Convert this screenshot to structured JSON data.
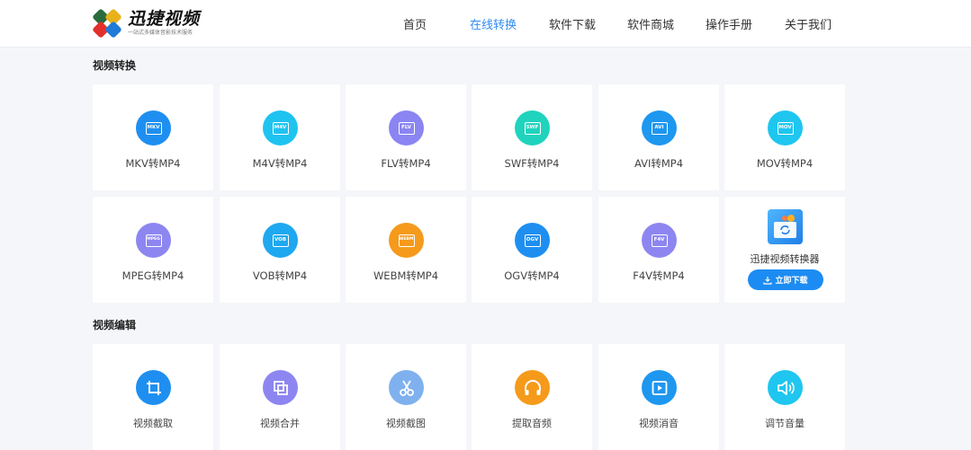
{
  "header": {
    "logo_title": "迅捷视频",
    "logo_subtitle": "一站式多媒体音影技术服务",
    "nav": [
      {
        "label": "首页",
        "active": false
      },
      {
        "label": "在线转换",
        "active": true
      },
      {
        "label": "软件下载",
        "active": false
      },
      {
        "label": "软件商城",
        "active": false
      },
      {
        "label": "操作手册",
        "active": false
      },
      {
        "label": "关于我们",
        "active": false
      }
    ]
  },
  "video_convert": {
    "title": "视频转换",
    "items": [
      {
        "format": "MKV",
        "label": "MKV转MP4",
        "color": "#1e8ff0"
      },
      {
        "format": "M4V",
        "label": "M4V转MP4",
        "color": "#1fc3f0"
      },
      {
        "format": "FLV",
        "label": "FLV转MP4",
        "color": "#8a85f2"
      },
      {
        "format": "SWF",
        "label": "SWF转MP4",
        "color": "#20d3bd"
      },
      {
        "format": "AVI",
        "label": "AVI转MP4",
        "color": "#1e97ef"
      },
      {
        "format": "MOV",
        "label": "MOV转MP4",
        "color": "#1fc6ef"
      },
      {
        "format": "MPEG",
        "label": "MPEG转MP4",
        "color": "#8d86f1"
      },
      {
        "format": "VOB",
        "label": "VOB转MP4",
        "color": "#1ea8f0"
      },
      {
        "format": "WEBM",
        "label": "WEBM转MP4",
        "color": "#f59a1b"
      },
      {
        "format": "OGV",
        "label": "OGV转MP4",
        "color": "#1e8ff0"
      },
      {
        "format": "F4V",
        "label": "F4V转MP4",
        "color": "#8d86f1"
      }
    ],
    "promo": {
      "label": "迅捷视频转换器",
      "button": "立即下载"
    }
  },
  "video_edit": {
    "title": "视频编辑",
    "items": [
      {
        "label": "视频截取",
        "icon": "crop-icon",
        "color": "#1e8ff0"
      },
      {
        "label": "视频合并",
        "icon": "merge-icon",
        "color": "#8d86f1"
      },
      {
        "label": "视频截图",
        "icon": "scissors-icon",
        "color": "#7fb1ee"
      },
      {
        "label": "提取音频",
        "icon": "headphones-icon",
        "color": "#f59a1b"
      },
      {
        "label": "视频消音",
        "icon": "play-icon",
        "color": "#1e97ef"
      },
      {
        "label": "调节音量",
        "icon": "speaker-icon",
        "color": "#1fc6ef"
      }
    ]
  }
}
